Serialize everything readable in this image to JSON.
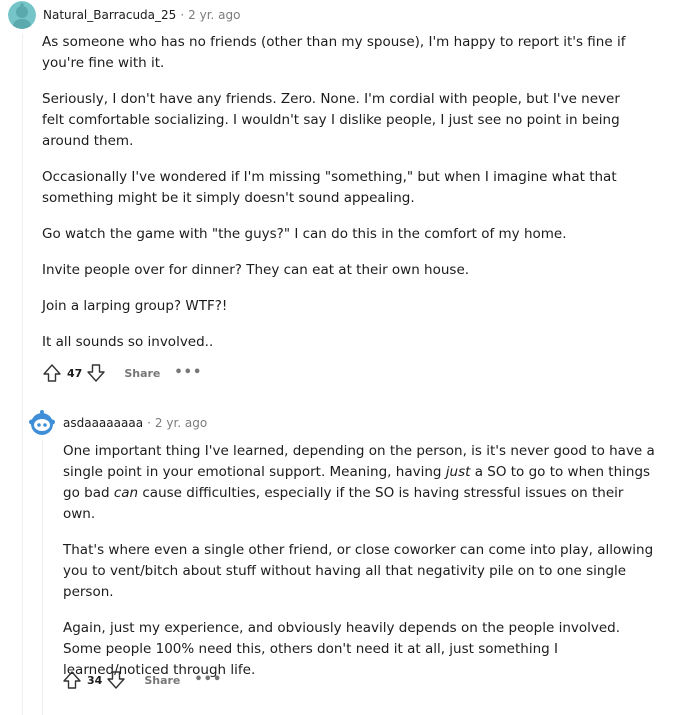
{
  "comments": [
    {
      "username": "Natural_Barracuda_25",
      "time": "2 yr. ago",
      "paragraphs": [
        "As someone who has no friends (other than my spouse), I'm happy to report it's fine if you're fine with it.",
        "Seriously, I don't have any friends. Zero. None. I'm cordial with people, but I've never felt comfortable socializing. I wouldn't say I dislike people, I just see no point in being around them.",
        "Occasionally I've wondered if I'm missing \"something,\" but when I imagine what that something might be it simply doesn't sound appealing.",
        "Go watch the game with \"the guys?\" I can do this in the comfort of my home.",
        "Invite people over for dinner? They can eat at their own house.",
        "Join a larping group? WTF?!",
        "It all sounds so involved.."
      ],
      "votes": "47",
      "share_label": "Share",
      "more_label": "•••"
    },
    {
      "username": "asdaaaaaaaa",
      "time": "2 yr. ago",
      "p1_a": "One important thing I've learned, depending on the person, is it's never good to have a single point in your emotional support. Meaning, having ",
      "p1_b": "just",
      "p1_c": " a SO to go to when things go bad ",
      "p1_d": "can",
      "p1_e": " cause difficulties, especially if the SO is having stressful issues on their own.",
      "p2": "That's where even a single other friend, or close coworker can come into play, allowing you to vent/bitch about stuff without having all that negativity pile on to one single person.",
      "p3": "Again, just my experience, and obviously heavily depends on the people involved. Some people 100% need this, others don't need it at all, just something I learned/noticed through life.",
      "votes": "34",
      "share_label": "Share",
      "more_label": "•••"
    }
  ],
  "colors": {
    "avatar1": "#74c4c8",
    "avatar2_bg": "#ffffff",
    "avatar2_body": "#3f8fd8",
    "thread_line": "#edeff1"
  }
}
